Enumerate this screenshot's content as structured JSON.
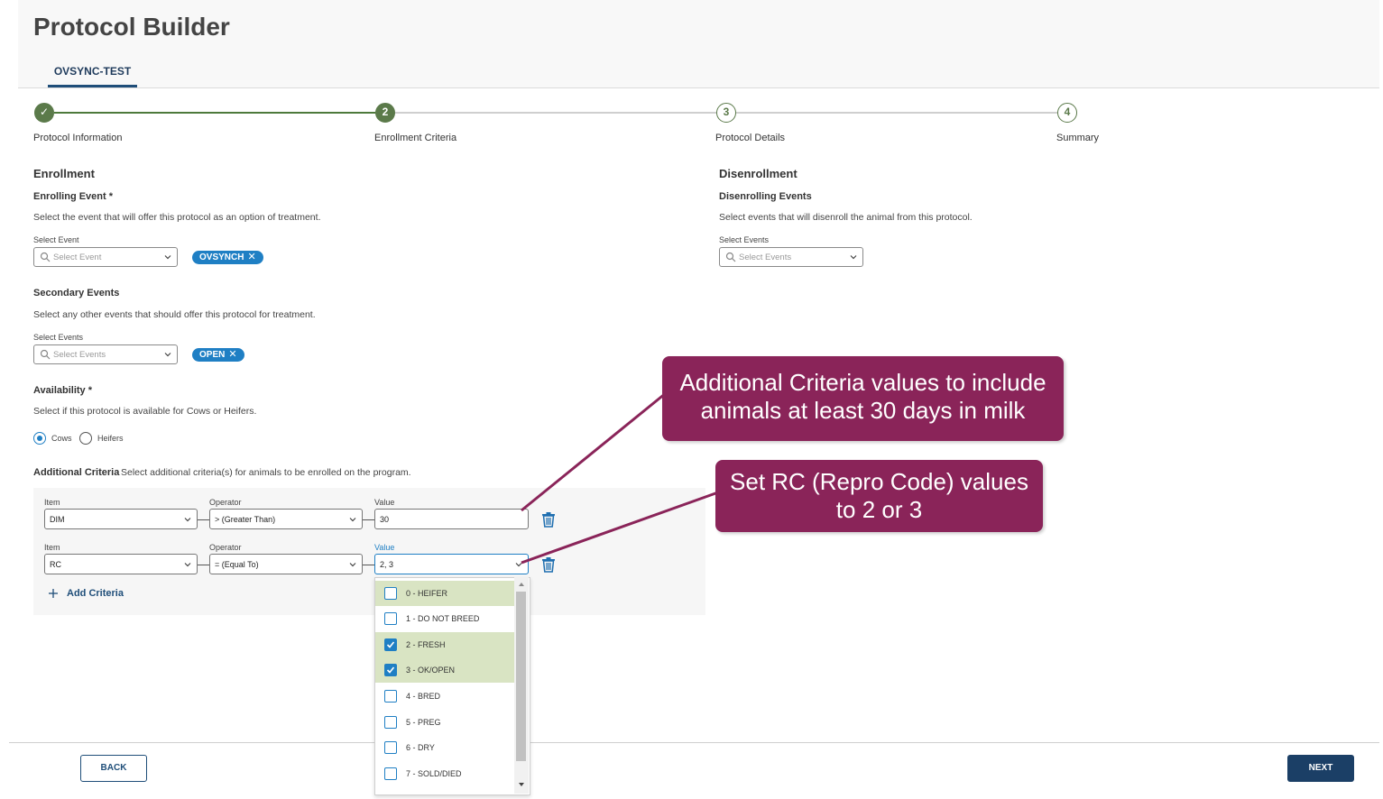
{
  "header": {
    "title": "Protocol Builder",
    "tab": "OVSYNC-TEST"
  },
  "steps": [
    {
      "number": "✓",
      "label": "Protocol Information",
      "state": "done"
    },
    {
      "number": "2",
      "label": "Enrollment Criteria",
      "state": "active"
    },
    {
      "number": "3",
      "label": "Protocol Details",
      "state": "pending"
    },
    {
      "number": "4",
      "label": "Summary",
      "state": "pending"
    }
  ],
  "enrollment": {
    "heading": "Enrollment",
    "enrolling_event": {
      "label": "Enrolling Event *",
      "description": "Select the event that will offer this protocol as an option of treatment.",
      "select_label": "Select Event",
      "placeholder": "Select Event",
      "chip": "OVSYNCH"
    },
    "secondary_events": {
      "label": "Secondary Events",
      "description": "Select any other events that should offer this protocol for treatment.",
      "select_label": "Select Events",
      "placeholder": "Select Events",
      "chip": "OPEN"
    },
    "availability": {
      "label": "Availability *",
      "description": "Select if this protocol is available for Cows or Heifers.",
      "option_cows": "Cows",
      "option_heifers": "Heifers",
      "selected": "Cows"
    },
    "additional_criteria": {
      "label": "Additional Criteria",
      "description": "Select additional criteria(s) for animals to be enrolled on the program.",
      "rows": [
        {
          "item_label": "Item",
          "item": "DIM",
          "operator_label": "Operator",
          "operator": "> (Greater Than)",
          "value_label": "Value",
          "value": "30"
        },
        {
          "item_label": "Item",
          "item": "RC",
          "operator_label": "Operator",
          "operator": "= (Equal To)",
          "value_label": "Value",
          "value": "2, 3"
        }
      ],
      "add_label": "Add Criteria"
    }
  },
  "disenrollment": {
    "heading": "Disenrollment",
    "label": "Disenrolling Events",
    "description": "Select events that will disenroll the animal from this protocol.",
    "select_label": "Select Events",
    "placeholder": "Select Events"
  },
  "rc_dropdown": {
    "options": [
      {
        "label": "0 - HEIFER",
        "checked": false,
        "highlight": true
      },
      {
        "label": "1 - DO NOT BREED",
        "checked": false,
        "highlight": false
      },
      {
        "label": "2 - FRESH",
        "checked": true,
        "highlight": true
      },
      {
        "label": "3 - OK/OPEN",
        "checked": true,
        "highlight": true
      },
      {
        "label": "4 - BRED",
        "checked": false,
        "highlight": false
      },
      {
        "label": "5 - PREG",
        "checked": false,
        "highlight": false
      },
      {
        "label": "6 - DRY",
        "checked": false,
        "highlight": false
      },
      {
        "label": "7 - SOLD/DIED",
        "checked": false,
        "highlight": false
      }
    ]
  },
  "footer": {
    "back_label": "BACK",
    "next_label": "NEXT"
  },
  "callouts": {
    "first_line1": "Additional Criteria values to include",
    "first_line2": "animals at least 30 days in milk",
    "second_line1": "Set RC (Repro Code) values",
    "second_line2": "to 2 or 3",
    "color": "#8a2459"
  },
  "colors": {
    "accent": "#1f7fc4",
    "step_green": "#5b7a4a",
    "nav_dark": "#1b3f66"
  }
}
